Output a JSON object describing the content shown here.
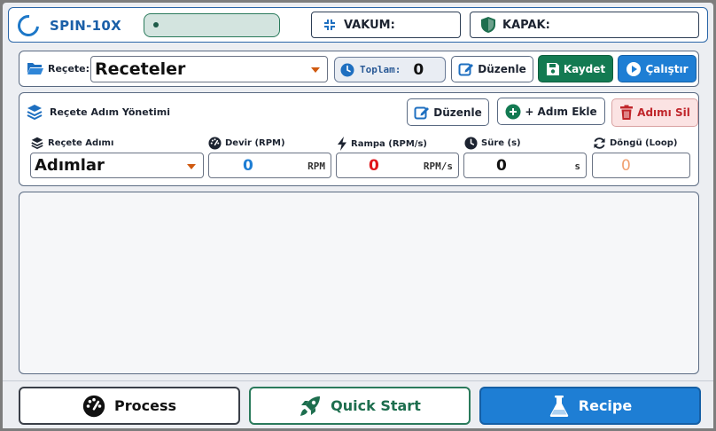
{
  "header": {
    "brand": "SPIN-10X",
    "vakum_label": "VAKUM:",
    "kapak_label": "KAPAK:"
  },
  "recipe_bar": {
    "label": "Reçete:",
    "select_value": "Receteler",
    "toplam_label": "Toplam:",
    "toplam_value": "0",
    "edit_label": "Düzenle",
    "save_label": "Kaydet",
    "run_label": "Çalıştır"
  },
  "steps": {
    "title": "Reçete Adım Yönetimi",
    "edit_label": "Düzenle",
    "add_label": "+ Adım Ekle",
    "delete_label": "Adımı Sil",
    "fields": {
      "step_label": "Reçete Adımı",
      "step_value": "Adımlar",
      "rpm_label": "Devir (RPM)",
      "rpm_value": "0",
      "rpm_unit": "RPM",
      "ramp_label": "Rampa (RPM/s)",
      "ramp_value": "0",
      "ramp_unit": "RPM/s",
      "time_label": "Süre (s)",
      "time_value": "0",
      "time_unit": "s",
      "loop_label": "Döngü (Loop)",
      "loop_value": "0"
    }
  },
  "nav": {
    "process": "Process",
    "quick_start": "Quick Start",
    "recipe": "Recipe"
  },
  "colors": {
    "accent_blue": "#1e7ed4",
    "accent_green": "#137a52",
    "danger_red": "#c0262b",
    "rpm_value": "#1e7ed4",
    "ramp_value": "#e0161b",
    "loop_value": "#f0a070"
  }
}
